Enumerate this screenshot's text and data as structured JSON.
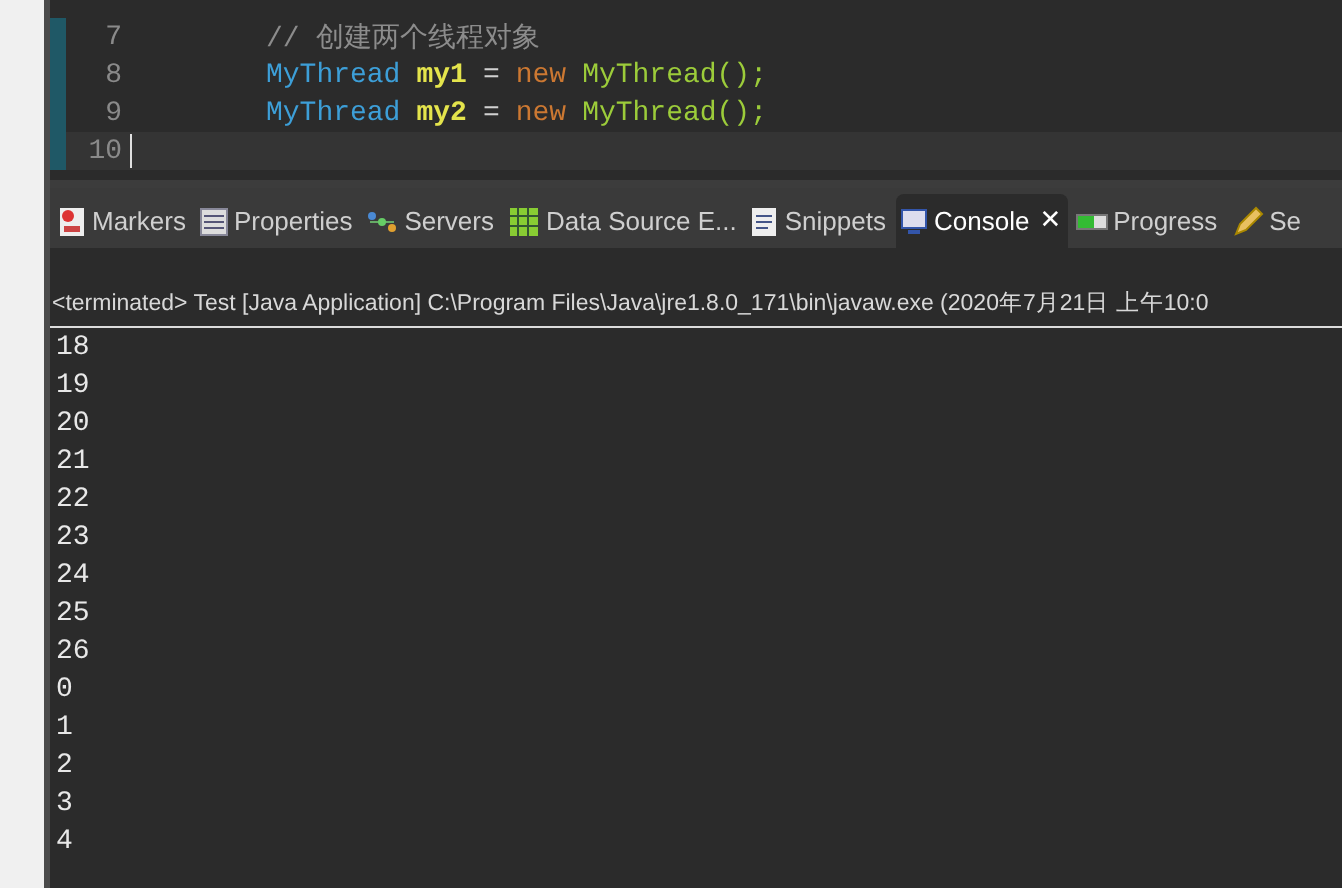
{
  "editor": {
    "lines": [
      {
        "number": "7",
        "tokens": [
          {
            "kind": "comment",
            "text": "// 创建两个线程对象"
          }
        ],
        "current": false
      },
      {
        "number": "8",
        "tokens": [
          {
            "kind": "type",
            "text": "MyThread"
          },
          {
            "kind": "variable",
            "text": "my1"
          },
          {
            "kind": "operator",
            "text": "="
          },
          {
            "kind": "keyword",
            "text": "new"
          },
          {
            "kind": "class",
            "text": "MyThread();"
          }
        ],
        "current": false
      },
      {
        "number": "9",
        "tokens": [
          {
            "kind": "type",
            "text": "MyThread"
          },
          {
            "kind": "variable",
            "text": "my2"
          },
          {
            "kind": "operator",
            "text": "="
          },
          {
            "kind": "keyword",
            "text": "new"
          },
          {
            "kind": "class",
            "text": "MyThread();"
          }
        ],
        "current": false
      },
      {
        "number": "10",
        "current": true
      }
    ]
  },
  "tabs": [
    {
      "label": "Markers",
      "selected": false
    },
    {
      "label": "Properties",
      "selected": false
    },
    {
      "label": "Servers",
      "selected": false
    },
    {
      "label": "Data Source E...",
      "selected": false
    },
    {
      "label": "Snippets",
      "selected": false
    },
    {
      "label": "Console",
      "selected": true,
      "close": "✕"
    },
    {
      "label": "Progress",
      "selected": false
    },
    {
      "label": "Se",
      "selected": false
    }
  ],
  "console": {
    "header": "<terminated> Test [Java Application] C:\\Program Files\\Java\\jre1.8.0_171\\bin\\javaw.exe  (2020年7月21日 上午10:0",
    "output": [
      "18",
      "19",
      "20",
      "21",
      "22",
      "23",
      "24",
      "25",
      "26",
      "0",
      "1",
      "2",
      "3",
      "4"
    ]
  }
}
